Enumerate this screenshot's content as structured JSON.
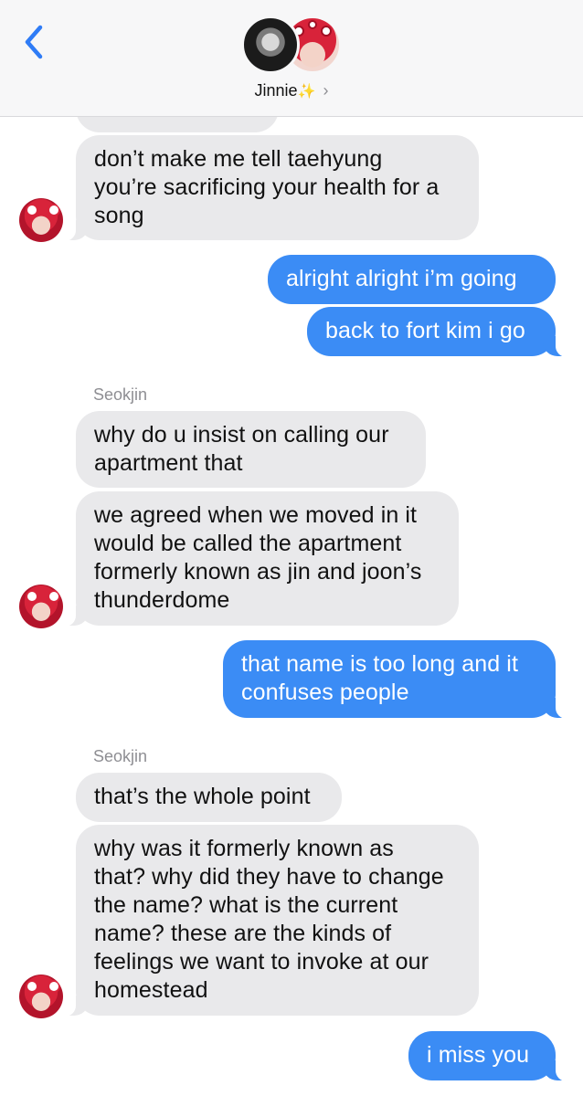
{
  "header": {
    "contact_name": "Jinnie",
    "sparkle": "✨",
    "chevron": "›"
  },
  "messages": {
    "m0": "",
    "m1": "don’t make me tell taehyung\nyou’re sacrificing your health for a\nsong",
    "m2": "alright alright i’m going",
    "m3": "back to fort kim i go",
    "sender1": "Seokjin",
    "m4": "why do u insist on calling our\napartment that",
    "m5": "we agreed when we moved in it\nwould be called the apartment\nformerly known as jin and joon’s\nthunderdome",
    "m6": "that name is too long and it\nconfuses people",
    "sender2": "Seokjin",
    "m7": "that’s the whole point",
    "m8": "why was it formerly known as\nthat? why did they have to change\nthe name? what is the current\nname? these are the kinds of\nfeelings we want to invoke at our\nhomestead",
    "m9": "i miss you"
  },
  "colors": {
    "incoming": "#e9e9eb",
    "outgoing": "#3b8cf5",
    "accent": "#2f7cf6"
  },
  "icons": {
    "back": "chevron-left-icon",
    "details": "chevron-right-icon"
  }
}
